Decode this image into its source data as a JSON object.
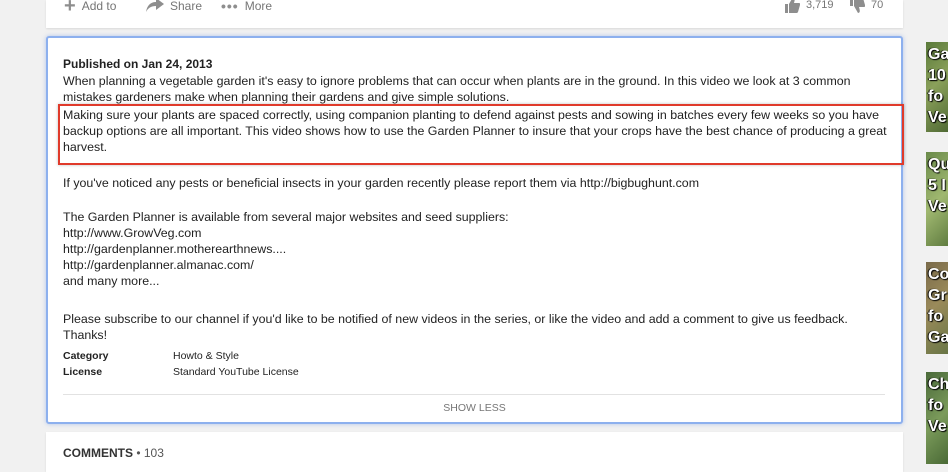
{
  "actions": {
    "add_label": "Add to",
    "share_label": "Share",
    "more_label": "More"
  },
  "votes": {
    "likes": "3,719",
    "dislikes": "70"
  },
  "description": {
    "published": "Published on Jan 24, 2013",
    "para1": "When planning a vegetable garden it's easy to ignore problems that can occur when plants are in the ground. In this video we look at 3 common",
    "para1b": "mistakes gardeners make when planning their gardens and give simple solutions.",
    "para2": "Making sure your plants are spaced correctly, using companion planting to defend against pests and sowing in batches every few weeks so you have backup options are all important. This video shows how to use the Garden Planner to insure that your crops have the best chance of producing a great harvest.",
    "para3": "If you've noticed any pests or beneficial insects in your garden recently please report them via http://bigbughunt.com",
    "para4": "The Garden Planner is available from several major websites and seed suppliers:\nhttp://www.GrowVeg.com\nhttp://gardenplanner.motherearthnews....\nhttp://gardenplanner.almanac.com/\nand many more...",
    "para5": "Please subscribe to our channel if you'd like to be notified of new videos in the series, or like the video and add a comment to give us feedback. Thanks!",
    "meta": [
      {
        "key": "Category",
        "value": "Howto & Style"
      },
      {
        "key": "License",
        "value": "Standard YouTube License"
      }
    ],
    "show_less": "SHOW LESS"
  },
  "comments": {
    "label": "COMMENTS",
    "count": "• 103"
  },
  "sidebar": {
    "thumbs": [
      {
        "text": "Ga\n10\nfo\nVe"
      },
      {
        "text": "Qu\n5 I\nVe"
      },
      {
        "text": "Co\nGr\nfo\nGa"
      },
      {
        "text": "Ch\nfo\nVe"
      }
    ]
  },
  "colors": {
    "highlight": "#e03a2b",
    "card_border": "#8db0ee"
  }
}
